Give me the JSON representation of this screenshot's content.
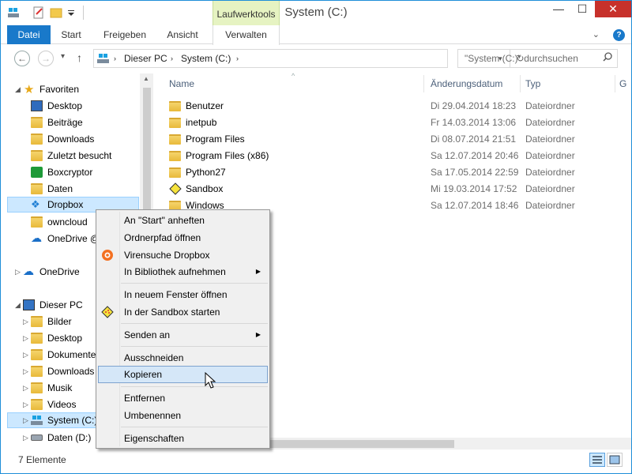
{
  "window": {
    "title": "System (C:)",
    "context_tab": "Laufwerktools",
    "controls": {
      "minimize": "—",
      "maximize": "☐",
      "close": "✕"
    }
  },
  "ribbon": {
    "tabs": [
      "Datei",
      "Start",
      "Freigeben",
      "Ansicht",
      "Verwalten"
    ],
    "expand": "⌄",
    "help": "?"
  },
  "nav": {
    "back": "←",
    "forward": "→",
    "recent": "▾",
    "up": "↑",
    "breadcrumbs": [
      "Dieser PC",
      "System (C:)"
    ],
    "search_placeholder": "\"System (C:)\" durchsuchen"
  },
  "tree": {
    "favorites": {
      "label": "Favoriten",
      "items": [
        "Desktop",
        "Beiträge",
        "Downloads",
        "Zuletzt besucht",
        "Boxcryptor",
        "Daten",
        "Dropbox",
        "owncloud",
        "OneDrive @"
      ]
    },
    "onedrive": "OneDrive",
    "thispc": {
      "label": "Dieser PC",
      "items": [
        "Bilder",
        "Desktop",
        "Dokumente",
        "Downloads",
        "Musik",
        "Videos",
        "System (C:)",
        "Daten (D:)"
      ]
    }
  },
  "filelist": {
    "columns": {
      "name": "Name",
      "date": "Änderungsdatum",
      "type": "Typ",
      "size": "G"
    },
    "rows": [
      {
        "name": "Benutzer",
        "date": "Di 29.04.2014 18:23",
        "type": "Dateiordner"
      },
      {
        "name": "inetpub",
        "date": "Fr 14.03.2014 13:06",
        "type": "Dateiordner"
      },
      {
        "name": "Program Files",
        "date": "Di 08.07.2014 21:51",
        "type": "Dateiordner"
      },
      {
        "name": "Program Files (x86)",
        "date": "Sa 12.07.2014 20:46",
        "type": "Dateiordner"
      },
      {
        "name": "Python27",
        "date": "Sa 17.05.2014 22:59",
        "type": "Dateiordner"
      },
      {
        "name": "Sandbox",
        "date": "Mi 19.03.2014 17:52",
        "type": "Dateiordner"
      },
      {
        "name": "Windows",
        "date": "Sa 12.07.2014 18:46",
        "type": "Dateiordner"
      }
    ]
  },
  "status": {
    "count": "7 Elemente"
  },
  "context_menu": {
    "items": [
      {
        "label": "An \"Start\" anheften"
      },
      {
        "label": "Ordnerpfad öffnen"
      },
      {
        "label": "Virensuche Dropbox"
      },
      {
        "label": "In Bibliothek aufnehmen"
      },
      {
        "label": "In neuem Fenster öffnen"
      },
      {
        "label": "In der Sandbox starten"
      },
      {
        "label": "Senden an"
      },
      {
        "label": "Ausschneiden"
      },
      {
        "label": "Kopieren"
      },
      {
        "label": "Entfernen"
      },
      {
        "label": "Umbenennen"
      },
      {
        "label": "Eigenschaften"
      }
    ],
    "highlighted": "Kopieren"
  },
  "colors": {
    "accent": "#1979ca",
    "context_tab_bg": "#e6f3c2",
    "selection": "#cce8ff",
    "menu_highlight": "#d5e7f8",
    "close_button": "#c7312b"
  }
}
